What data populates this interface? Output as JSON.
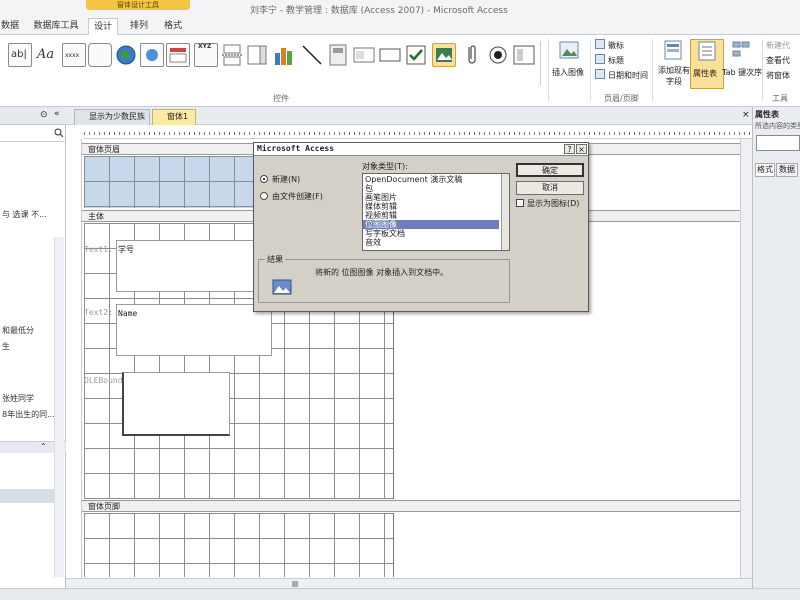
{
  "window": {
    "title": "刘李宁 - 教学管理 : 数据库 (Access 2007) - Microsoft Access",
    "context_tab": "窗体设计工具"
  },
  "ribbon_tabs": [
    "数据",
    "数据库工具",
    "设计",
    "排列",
    "格式"
  ],
  "ribbon": {
    "controls_group": "控件",
    "header_footer_group": "页眉/页脚",
    "tools_group": "工具",
    "insert_image": "插入图像",
    "logo": "徽标",
    "title_btn": "标题",
    "datetime": "日期和时间",
    "add_existing": "添加现有字段",
    "property_sheet": "属性表",
    "tab_order": "Tab 键次序",
    "new_window": "新建代",
    "view_code": "查看代",
    "convert": "将窗体",
    "glyphs": {
      "ab": "ab|",
      "aa": "Aa",
      "xxx": "xxxx",
      "xyz": "XYZ"
    }
  },
  "nav": {
    "items": [
      "与 选课 不...",
      "和最低分",
      "生",
      "张姓同学",
      "8年出生的同..."
    ],
    "chevron": "⊙",
    "collapse": "⌃"
  },
  "doc_tabs": [
    "显示为少数民族",
    "窗体1"
  ],
  "sections": {
    "header": "窗体页眉",
    "detail": "主体",
    "footer": "窗体页脚"
  },
  "form_controls": {
    "text1_label": "Text1:",
    "text1_value": "学号",
    "text2_label": "Text2:",
    "text2_value": "Name",
    "ole_label": "OLEBound"
  },
  "props": {
    "title": "属性表",
    "subtitle": "所选内容的类型",
    "tabs": [
      "格式",
      "数据"
    ]
  },
  "dialog": {
    "title": "Microsoft Access",
    "help": "?",
    "close": "×",
    "radio_new": "新建(N)",
    "radio_file": "由文件创建(F)",
    "type_label": "对象类型(T):",
    "ok": "确定",
    "cancel": "取消",
    "show_icon": "显示为图标(D)",
    "list_items": [
      "OpenDocument 演示文稿",
      "包",
      "画笔图片",
      "媒体剪辑",
      "视频剪辑",
      "位图图像",
      "写字板文档",
      "音效"
    ],
    "selected_index": 5,
    "result_label": "结果",
    "result_text": "将新的 位图图像 对象插入到文档中。"
  }
}
